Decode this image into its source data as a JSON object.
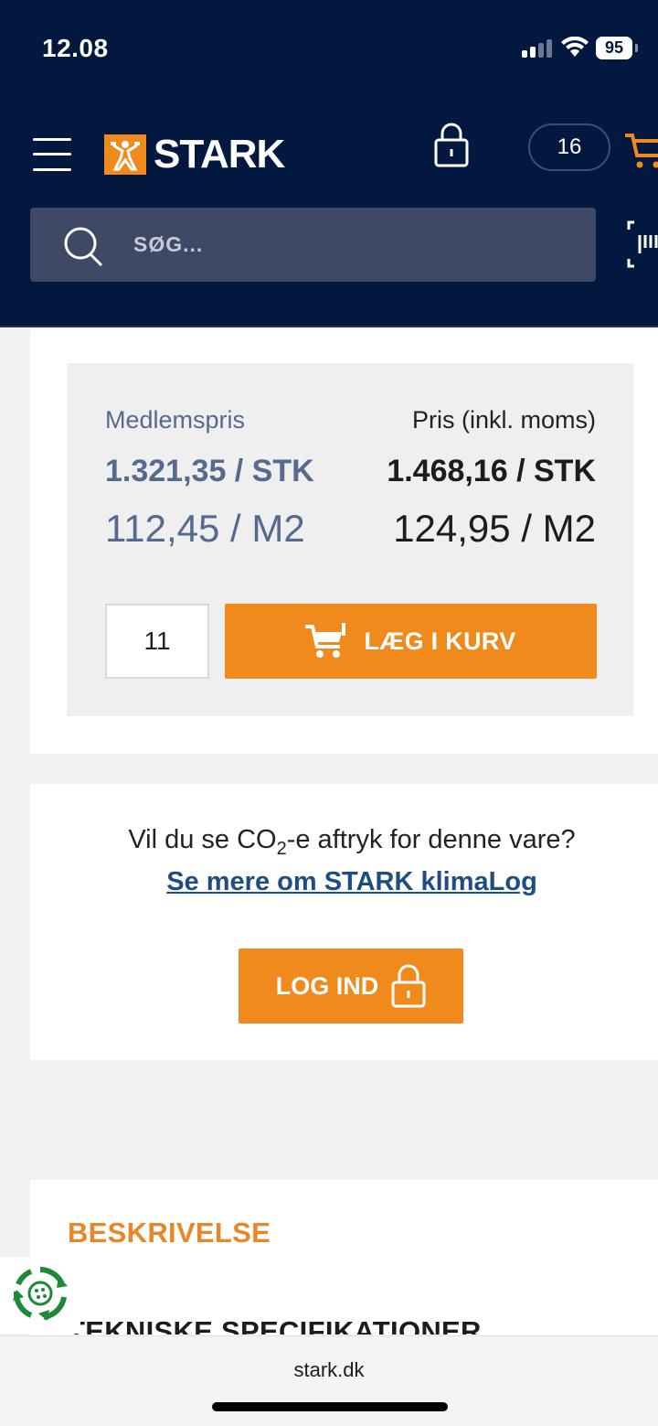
{
  "status_bar": {
    "time": "12.08",
    "battery": "95"
  },
  "header": {
    "brand": "STARK",
    "cart_count": "16",
    "search_placeholder": "SØG..."
  },
  "pricing": {
    "member_label": "Medlemspris",
    "member_price_unit": "1.321,35 / STK",
    "member_price_area": "112,45 / M2",
    "price_label": "Pris (inkl. moms)",
    "price_unit": "1.468,16 / STK",
    "price_area": "124,95 / M2",
    "quantity": "11",
    "add_to_cart_label": "LÆG I KURV"
  },
  "climate": {
    "question_prefix": "Vil du se CO",
    "question_sub": "2",
    "question_suffix": "-e aftryk for denne vare?",
    "link_text": "Se mere om STARK klimaLog",
    "login_label": "LOG IND"
  },
  "sections": {
    "description_title": "BESKRIVELSE",
    "specs_title": "TEKNISKE SPECIFIKATIONER"
  },
  "browser": {
    "url": "stark.dk"
  },
  "colors": {
    "navy": "#02183f",
    "orange": "#f08a1c",
    "member_blue": "#56698f",
    "link_blue": "#1e4d83",
    "eco_green": "#1d8a3a"
  }
}
